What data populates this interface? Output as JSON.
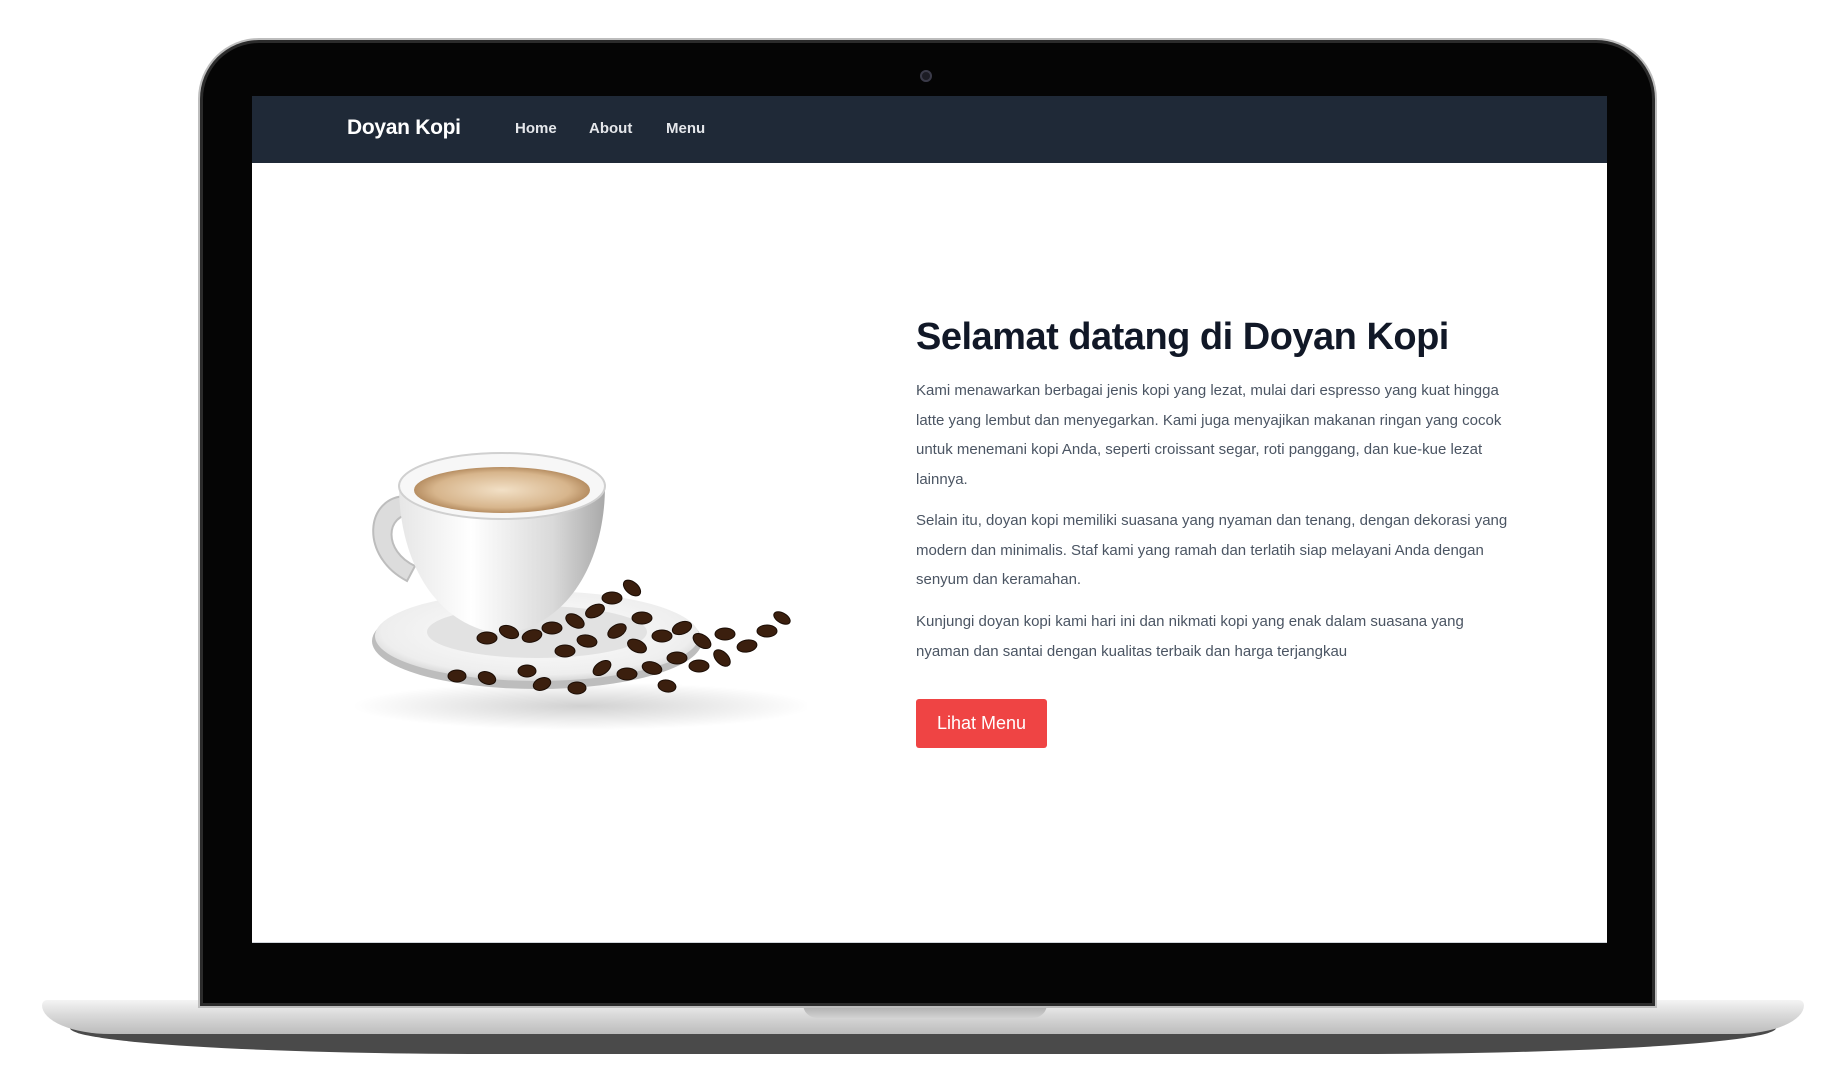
{
  "navbar": {
    "brand": "Doyan Kopi",
    "links": [
      "Home",
      "About",
      "Menu"
    ]
  },
  "hero": {
    "title": "Selamat datang di Doyan Kopi",
    "paragraphs": [
      "Kami menawarkan berbagai jenis kopi yang lezat, mulai dari espresso yang kuat hingga latte yang lembut dan menyegarkan. Kami juga menyajikan makanan ringan yang cocok untuk menemani kopi Anda, seperti croissant segar, roti panggang, dan kue-kue lezat lainnya.",
      "Selain itu, doyan kopi memiliki suasana yang nyaman dan tenang, dengan dekorasi yang modern dan minimalis. Staf kami yang ramah dan terlatih siap melayani Anda dengan senyum dan keramahan.",
      "Kunjungi doyan kopi kami hari ini dan nikmati kopi yang enak dalam suasana yang nyaman dan santai dengan kualitas terbaik dan harga terjangkau"
    ],
    "cta_label": "Lihat Menu",
    "image": "coffee-cup-with-beans"
  },
  "colors": {
    "navbar_bg": "#1f2937",
    "cta_bg": "#ef4444",
    "title_text": "#111827",
    "body_text": "#4b5563"
  }
}
